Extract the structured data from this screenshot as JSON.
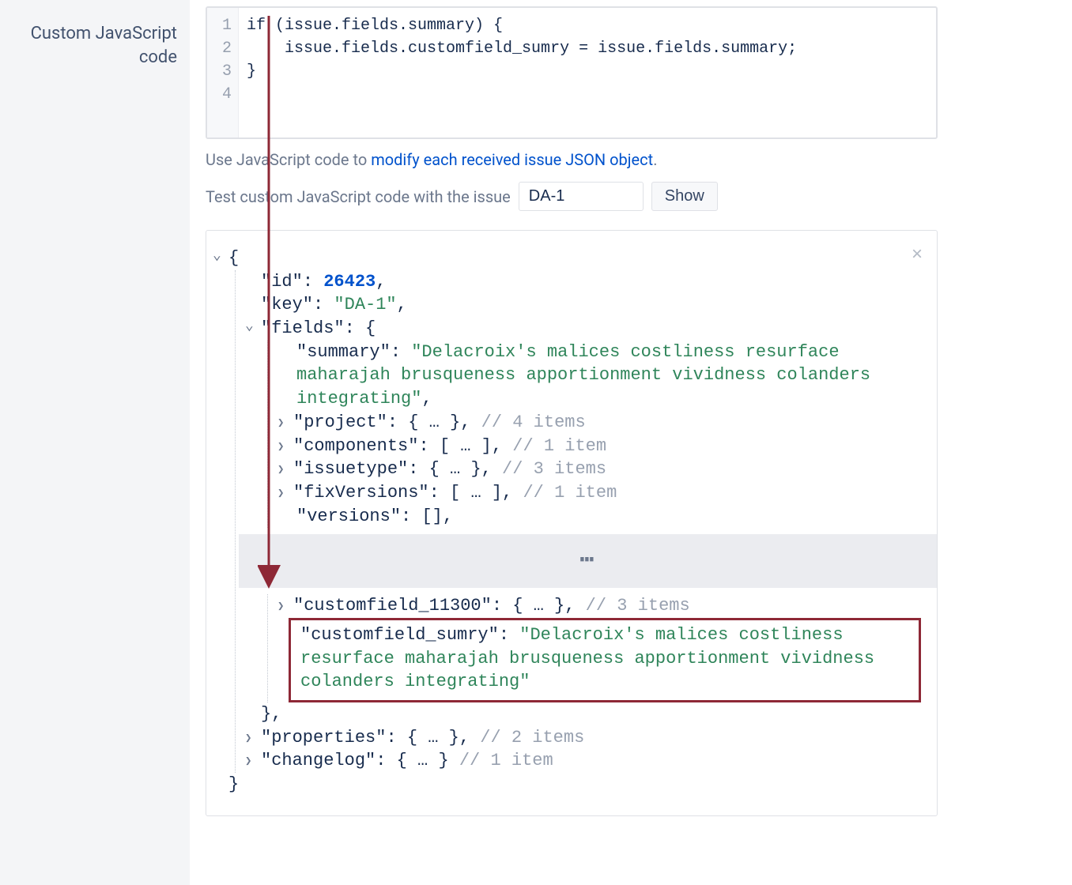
{
  "sidebar": {
    "label": "Custom JavaScript code"
  },
  "editor": {
    "lines": [
      "1",
      "2",
      "3",
      "4"
    ],
    "line1": "if (issue.fields.summary) {",
    "line2": "    issue.fields.customfield_sumry = issue.fields.summary;",
    "line3": "}",
    "line4": ""
  },
  "helper": {
    "prefix": "Use JavaScript code to ",
    "link": "modify each received issue JSON object",
    "suffix": "."
  },
  "test": {
    "label": "Test custom JavaScript code with the issue",
    "issue_value": "DA-1",
    "show_label": "Show"
  },
  "json": {
    "id_key": "\"id\"",
    "id_val": "26423",
    "key_key": "\"key\"",
    "key_val": "\"DA-1\"",
    "fields_key": "\"fields\"",
    "summary_key": "\"summary\"",
    "summary_val": "\"Delacroix's malices costliness resurface maharajah brusqueness apportionment vividness colanders integrating\"",
    "project_key": "\"project\"",
    "project_rest": ": { … },",
    "project_comm": " // 4 items",
    "components_key": "\"components\"",
    "components_rest": ": [ … ],",
    "components_comm": " // 1 item",
    "issuetype_key": "\"issuetype\"",
    "issuetype_rest": ": { … },",
    "issuetype_comm": " // 3 items",
    "fixv_key": "\"fixVersions\"",
    "fixv_rest": ": [ … ],",
    "fixv_comm": " // 1 item",
    "versions_key": "\"versions\"",
    "versions_rest": ": [],",
    "cf11300_key": "\"customfield_11300\"",
    "cf11300_rest": ": { … },",
    "cf11300_comm": " // 3 items",
    "cfsum_key": "\"customfield_sumry\"",
    "cfsum_val": "\"Delacroix's malices costliness resurface maharajah brusqueness apportionment vividness colanders integrating\"",
    "properties_key": "\"properties\"",
    "properties_rest": ": { … },",
    "properties_comm": " // 2 items",
    "changelog_key": "\"changelog\"",
    "changelog_rest": ": { … }",
    "changelog_comm": " // 1 item",
    "ellipsis": "⋯"
  }
}
